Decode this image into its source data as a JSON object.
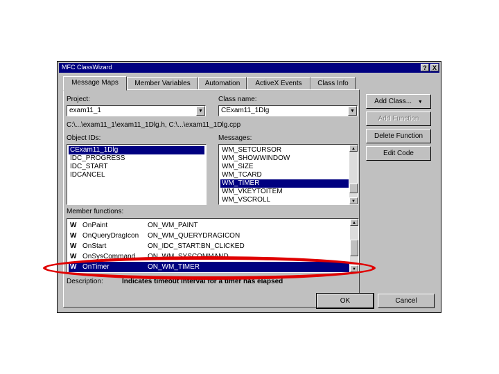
{
  "window": {
    "title": "MFC ClassWizard",
    "help_button": "?",
    "close_button": "X"
  },
  "tabs": [
    {
      "label": "Message Maps",
      "active": true
    },
    {
      "label": "Member Variables",
      "active": false
    },
    {
      "label": "Automation",
      "active": false
    },
    {
      "label": "ActiveX Events",
      "active": false
    },
    {
      "label": "Class Info",
      "active": false
    }
  ],
  "project": {
    "label": "Project:",
    "value": "exam11_1"
  },
  "class_name": {
    "label": "Class name:",
    "value": "CExam11_1Dlg"
  },
  "file_path": "C:\\...\\exam11_1\\exam11_1Dlg.h, C:\\...\\exam11_1Dlg.cpp",
  "object_ids": {
    "label": "Object IDs:",
    "items": [
      "CExam11_1Dlg",
      "IDC_PROGRESS",
      "IDC_START",
      "IDCANCEL"
    ],
    "selected_index": 0
  },
  "messages": {
    "label": "Messages:",
    "items": [
      "WM_SETCURSOR",
      "WM_SHOWWINDOW",
      "WM_SIZE",
      "WM_TCARD",
      "WM_TIMER",
      "WM_VKEYTOITEM",
      "WM_VSCROLL"
    ],
    "selected_index": 4
  },
  "member_functions": {
    "label": "Member functions:",
    "rows": [
      {
        "marker": "W",
        "name": "OnPaint",
        "handler": "ON_WM_PAINT"
      },
      {
        "marker": "W",
        "name": "OnQueryDragIcon",
        "handler": "ON_WM_QUERYDRAGICON"
      },
      {
        "marker": "W",
        "name": "OnStart",
        "handler": "ON_IDC_START:BN_CLICKED"
      },
      {
        "marker": "W",
        "name": "OnSysCommand",
        "handler": "ON_WM_SYSCOMMAND"
      },
      {
        "marker": "W",
        "name": "OnTimer",
        "handler": "ON_WM_TIMER"
      }
    ],
    "selected_index": 4
  },
  "description": {
    "label": "Description:",
    "text": "Indicates timeout interval for a timer has elapsed"
  },
  "buttons": {
    "add_class": "Add Class...",
    "add_function": "Add Function",
    "delete_function": "Delete Function",
    "edit_code": "Edit Code",
    "ok": "OK",
    "cancel": "Cancel"
  },
  "annotation_color": "#e00000"
}
